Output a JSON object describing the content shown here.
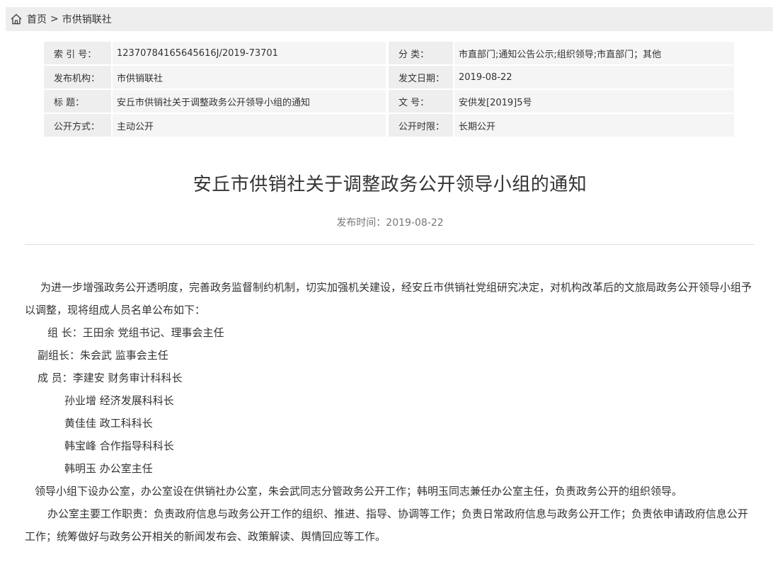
{
  "breadcrumb": {
    "home": "首页",
    "separator": ">",
    "current": "市供销联社"
  },
  "meta": {
    "index_label": "索 引 号：",
    "index_value": "12370784165645616J/2019-73701",
    "category_label": "分 类：",
    "category_value": "市直部门;通知公告公示;组织领导;市直部门；其他",
    "publisher_label": "发布机构：",
    "publisher_value": "市供销联社",
    "date_label": "发文日期：",
    "date_value": "2019-08-22",
    "title_label": "标 题：",
    "title_value": "安丘市供销社关于调整政务公开领导小组的通知",
    "docno_label": "文 号：",
    "docno_value": "安供发[2019]5号",
    "method_label": "公开方式：",
    "method_value": "主动公开",
    "period_label": "公开时限：",
    "period_value": "长期公开"
  },
  "article": {
    "title": "安丘市供销社关于调整政务公开领导小组的通知",
    "publish_time": "发布时间：2019-08-22",
    "paragraphs": {
      "p1": "为进一步增强政务公开透明度，完善政务监督制约机制，切实加强机关建设，经安丘市供销社党组研究决定，对机构改革后的文旅局政务公开领导小组予以调整，现将组成人员名单公布如下：",
      "leader": "组 长：王田余 党组书记、理事会主任",
      "deputy": "副组长：朱会武 监事会主任",
      "member1": "成 员：李建安 财务审计科科长",
      "member2": "孙业增 经济发展科科长",
      "member3": "黄佳佳 政工科科长",
      "member4": "韩宝峰 合作指导科科长",
      "member5": "韩明玉 办公室主任",
      "p2": "领导小组下设办公室，办公室设在供销社办公室，朱会武同志分管政务公开工作；韩明玉同志兼任办公室主任，负责政务公开的组织领导。",
      "p3": "办公室主要工作职责：负责政府信息与政务公开工作的组织、推进、指导、协调等工作；负责日常政府信息与政务公开工作；负责依申请政府信息公开工作；统筹做好与政务公开相关的新闻发布会、政策解读、舆情回应等工作。"
    }
  }
}
